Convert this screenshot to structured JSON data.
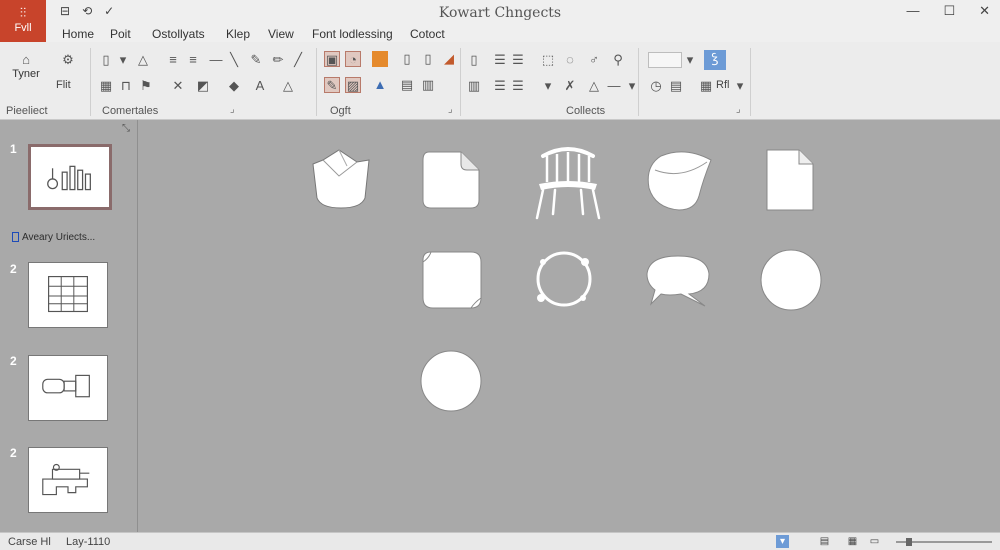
{
  "window": {
    "title": "Kowart Chngects",
    "controls": [
      "—",
      "☐",
      "✕"
    ]
  },
  "file_tab": {
    "glyph": "⫶⫶",
    "label": "Fvll"
  },
  "quick_access": [
    "⊟",
    "⟲",
    "✓"
  ],
  "menu": {
    "tabs": [
      "Home",
      "Poit",
      "Ostollyats",
      "Klep",
      "View",
      "Font lodlessing",
      "Cotoct"
    ]
  },
  "ribbon": {
    "tyner_label": "Tyner",
    "flit_label": "Flit",
    "groups": [
      "Pieeliect",
      "Comertales",
      "Ogft",
      "Collects"
    ],
    "adjust_label": "Rfl",
    "accent_color": "#6d9bd6"
  },
  "thumbnails": {
    "numbers": [
      "1",
      "2",
      "2",
      "2"
    ],
    "objects_link": "Aveary Uriects..."
  },
  "canvas_shapes": [
    "folded-basket-icon",
    "document-corner-icon",
    "chair-icon",
    "fish-blob-icon",
    "page-icon",
    "rounded-card-icon",
    "circle-loop-icon",
    "speech-bubble-icon",
    "circle-icon",
    "circle-icon"
  ],
  "statusbar": {
    "left": "Carse Hl",
    "layout": "Lay-1110",
    "icons": [
      "notes-icon",
      "normal-view-icon",
      "slide-sorter-icon",
      "reading-view-icon"
    ]
  }
}
